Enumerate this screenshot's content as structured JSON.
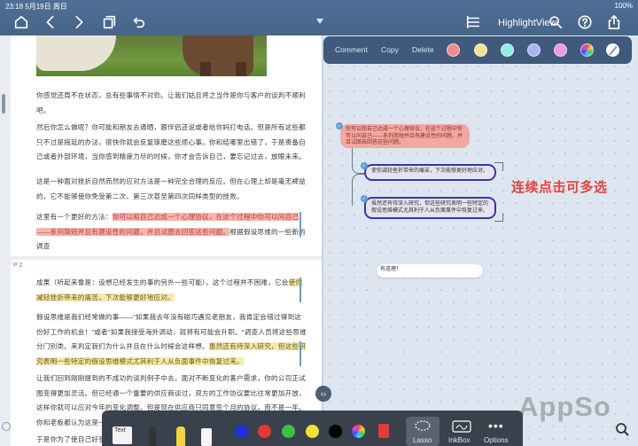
{
  "status_bar": {
    "time_date": "23:18   5月19日 周日",
    "battery": "100%"
  },
  "toolbar": {
    "view_title": "HighlightView"
  },
  "doc": {
    "page1_paragraphs": [
      {
        "text": "你感觉还周不在状态，总有些事情不对劲。让我们姑且将之当作是你与客户的谈判不顺利吧。"
      },
      {
        "text": "然后你怎么做呢？你可能和朋友去通晒，跟伴侣还说或者给你妈打电话。但是所有这些都只不过是拖延的办法，很快你就会反复琢磨这些烦心事。你和结哪里出错了，于是责备自己或者外部环境，当你感到精疲力尽的时候，你才会告诉自己，要忘记过去，放眼未来。"
      },
      {
        "text": "这是一种面对挫折自然而然的应对方法是一种完全合理的反应。但在心理上却是毫无裨益的，它不能够使你免受第二次、第三次甚至第四次同样类型的挫败。"
      }
    ],
    "page1_hl_prefix": "这里有一个更好的方法：",
    "page1_hl_red": "你可以和自己达成一个心理协议，在这个过程中你可以问自己——系列简短并且有建设性的问题，并且试图去回答这些问题。",
    "page1_hl_suffix": "根据假设思维的一些新的调查",
    "page2_label": "P 2",
    "page2_para1_prefix": "成果（听起来像是：设想已经发生的事的另外一些可能），这个过程并不困难，它会",
    "page2_para1_hl": "使你减轻挫折带来的痛苦，下次能够更好地应对。",
    "page2_para2_prefix": "假设思维是我们经常做的事——\"如果我去年没有碰巧遇见老朋友，我肯定会错过得到这份好工作的机会！\"或者\"如果我接受海外调动，就将有可能会升职。\"调查人员将这些思维分门别类。来判定我们为什么并且在什么时候会这样想。",
    "page2_para2_hl": "虽然还有待深入研究，但这些研究表明一些特定的假设思维模式尤其利于人从负面事件中恢复过来。",
    "page2_para3": "让我们回到刚刚提到的不成功的谈判例子中去。面对不断变化的客户需求，你的公司正试图变得更加灵活。但已经通一个重要的供应商谈过，双方的工作协议要比往常更加开放，这样你就可以应对今年的变化调整。但是现在供应商只同意签个月的协议，而不是一年。你和老板都认为这是一次不常常失败的谈判。",
    "page2_para4": "于是你为了使自己好受"
  },
  "context_menu": {
    "actions": [
      "Comment",
      "Copy",
      "Delete"
    ],
    "colors": [
      "#f28a8a",
      "#f7e18a",
      "#8ff0e3",
      "#a9b4f6",
      "#f29bd9"
    ]
  },
  "mindmap": {
    "node_red": "你可以和自己达成一个心理协议，在这个过程中你可以问自己——系列简短并且有建设性的问题，并且试图去回答这些问题。",
    "node_blue1": "使你减轻挫折带来的痛苦，下次能够更好地应对。",
    "node_blue2": "虽然还有待深入研究，但这些研究表明一些特定的假设思维模式尤其利于人从负面事件中恢复过来。",
    "node_white": "有道理！",
    "annotation": "连续点击可多选"
  },
  "bottom_tools": {
    "text_label": "Text",
    "colors": [
      "#1d2fe0",
      "#e43a2e",
      "#3ec043",
      "#f2e233",
      "#000000"
    ],
    "lasso_label": "Lasso",
    "inkbox_label": "InkBox",
    "options_label": "Options"
  },
  "watermark": "AppSo"
}
